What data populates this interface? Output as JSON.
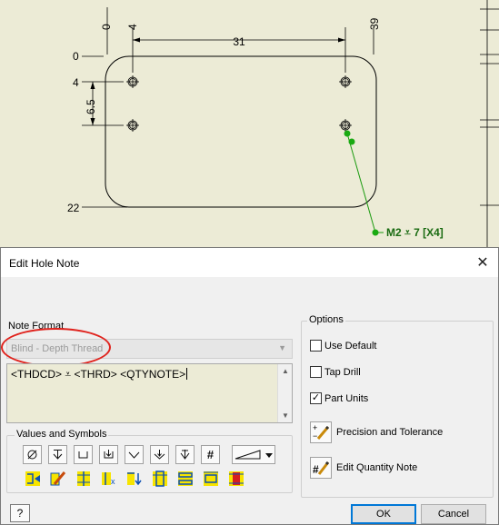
{
  "drawing": {
    "dims": {
      "top_31": "31",
      "col_0": "0",
      "col_4": "4",
      "col_39": "39",
      "row_0": "0",
      "row_4": "4",
      "row_22": "22",
      "vert_6_5": "6.5"
    },
    "hole_note": "M2 ⩡ 7 [X4]"
  },
  "dialog": {
    "title": "Edit Hole Note",
    "close_glyph": "✕",
    "note_format_label": "Note Format",
    "note_format_value": "Blind - Depth Thread",
    "note_text": "<THDCD> ⩡ <THRD> <QTYNOTE>",
    "values_label": "Values and Symbols",
    "symbols_row1": [
      "diameter-symbol",
      "depth-symbol",
      "counterbore-symbol",
      "spotface-symbol",
      "countersink-symbol",
      "counterdrill-symbol",
      "thread-depth-symbol",
      "number-symbol"
    ],
    "symbols_row2": [
      "thread-value",
      "edit-value",
      "hole-depth-value",
      "quantity-value",
      "drill-depth-value",
      "counterbore-value",
      "countersink-value",
      "spotface-value",
      "tolerance-value"
    ],
    "options_label": "Options",
    "options": {
      "use_default": {
        "label": "Use Default",
        "checked": false
      },
      "tap_drill": {
        "label": "Tap Drill",
        "checked": false
      },
      "part_units": {
        "label": "Part Units",
        "checked": true
      }
    },
    "check_glyph": "✓",
    "precision_label": "Precision and Tolerance",
    "edit_quantity_label": "Edit Quantity Note",
    "help_glyph": "?",
    "ok_label": "OK",
    "cancel_label": "Cancel"
  },
  "colors": {
    "drawing_bg": "#ecebd6",
    "leader_green": "#1a9a0e",
    "annotation_red": "#e0231d"
  }
}
